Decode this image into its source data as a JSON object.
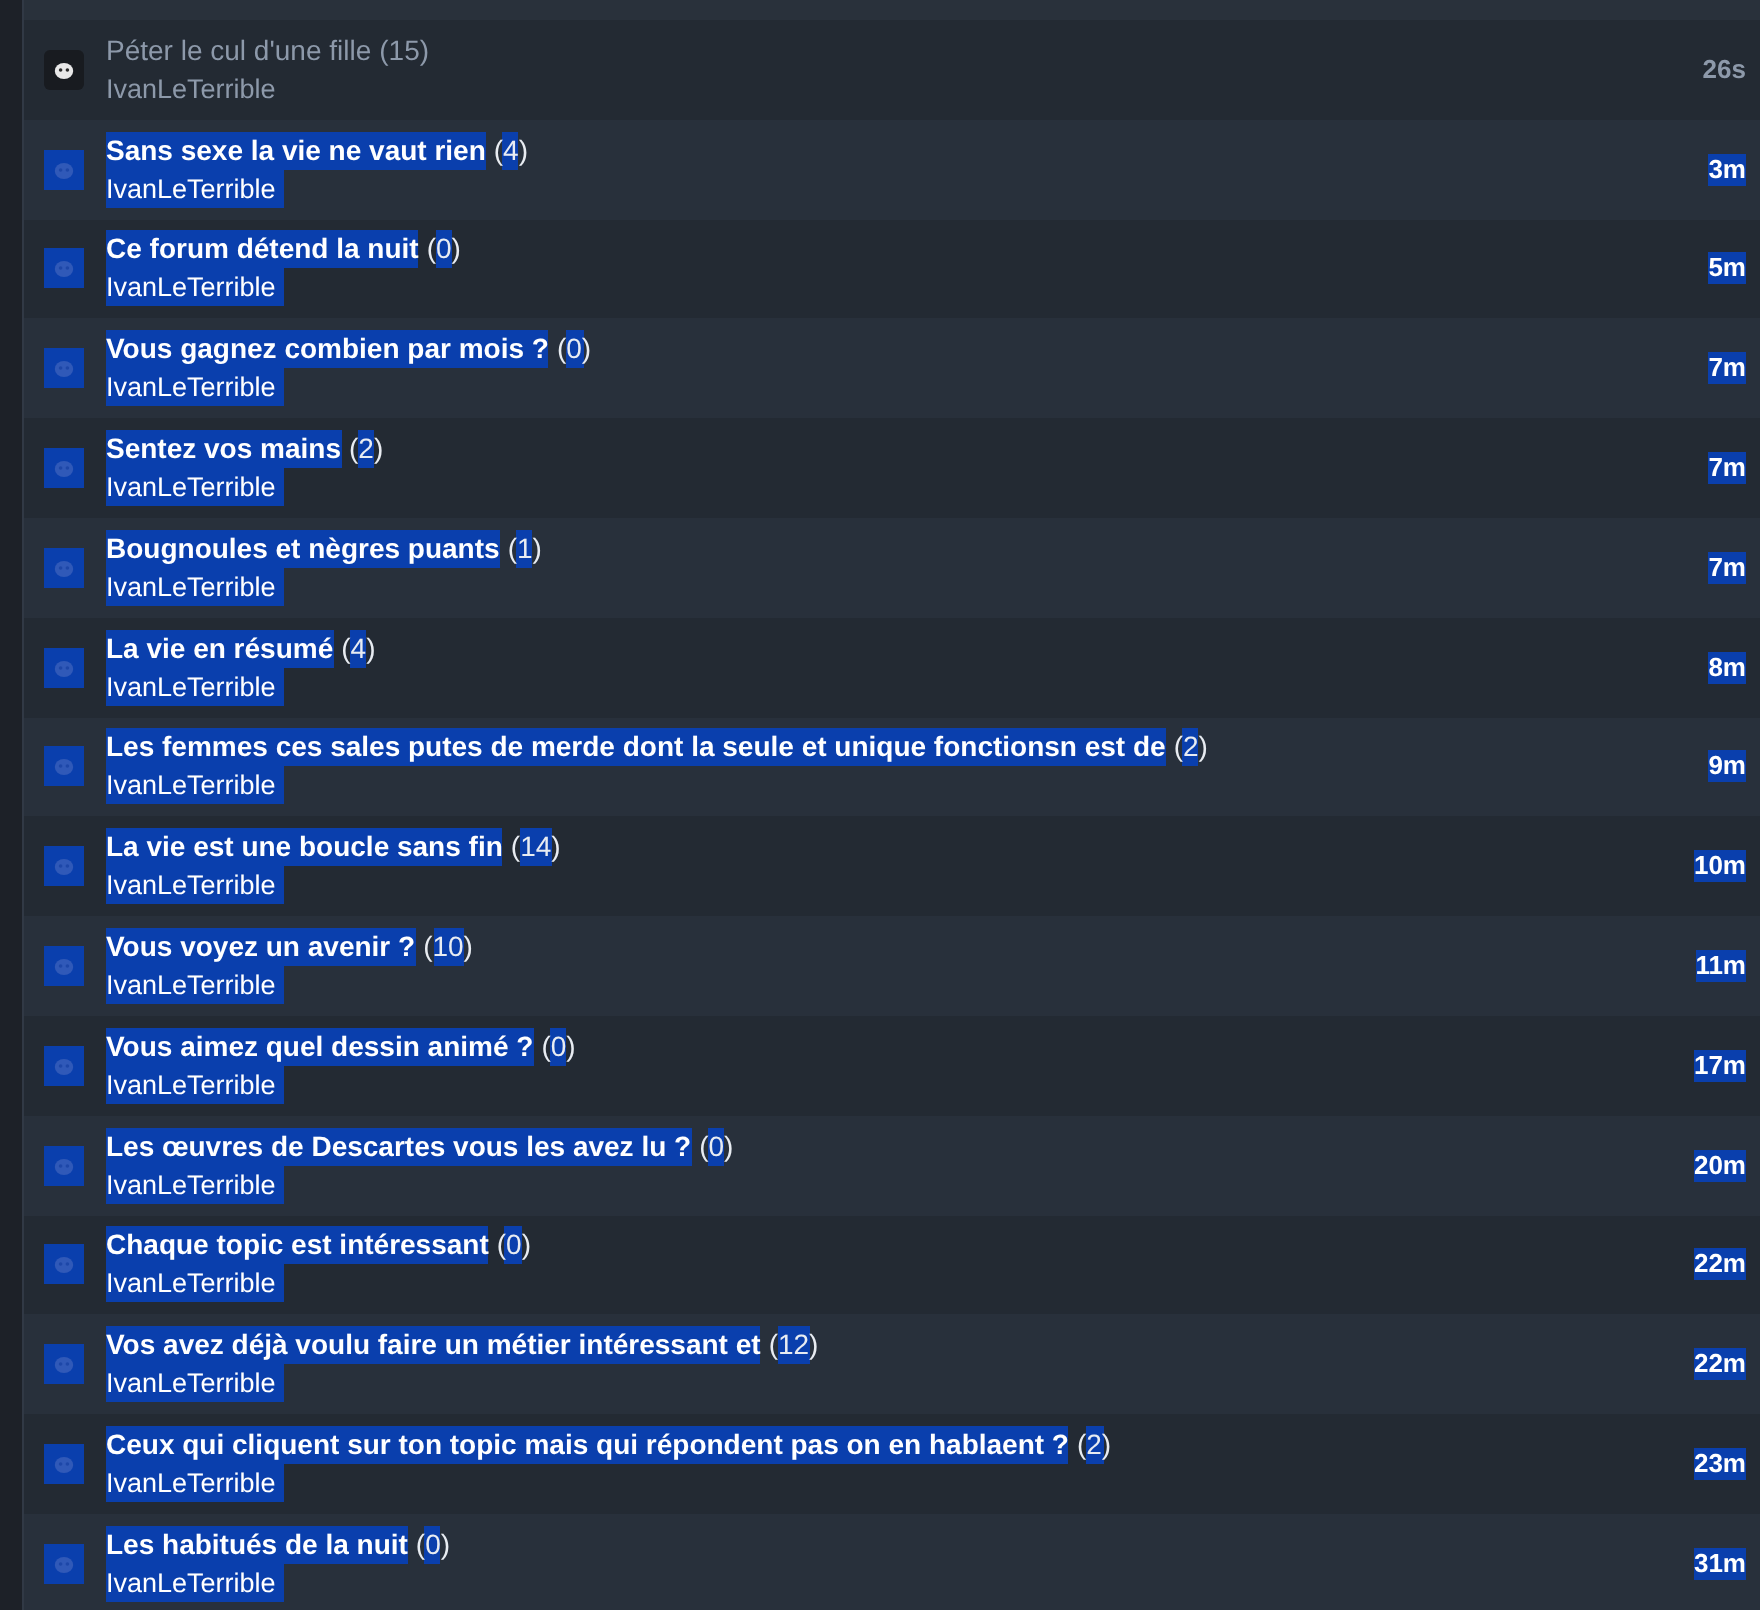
{
  "topics": [
    {
      "title": "Péter le cul d'une fille",
      "count": "(15)",
      "author": "IvanLeTerrible",
      "time": "26s",
      "selected": false
    },
    {
      "title": "Sans sexe la vie ne vaut rien",
      "count": "(4)",
      "author": "IvanLeTerrible",
      "time": "3m",
      "selected": true
    },
    {
      "title": "Ce forum détend la nuit",
      "count": "(0)",
      "author": "IvanLeTerrible",
      "time": "5m",
      "selected": true
    },
    {
      "title": "Vous gagnez combien par mois ?",
      "count": "(0)",
      "author": "IvanLeTerrible",
      "time": "7m",
      "selected": true
    },
    {
      "title": "Sentez vos mains",
      "count": "(2)",
      "author": "IvanLeTerrible",
      "time": "7m",
      "selected": true
    },
    {
      "title": "Bougnoules et nègres puants",
      "count": "(1)",
      "author": "IvanLeTerrible",
      "time": "7m",
      "selected": true
    },
    {
      "title": "La vie en résumé",
      "count": "(4)",
      "author": "IvanLeTerrible",
      "time": "8m",
      "selected": true
    },
    {
      "title": "Les femmes ces sales putes de merde dont la seule et unique fonctionsn est de",
      "count": "(2)",
      "author": "IvanLeTerrible",
      "time": "9m",
      "selected": true
    },
    {
      "title": "La vie est une boucle sans fin",
      "count": "(14)",
      "author": "IvanLeTerrible",
      "time": "10m",
      "selected": true
    },
    {
      "title": "Vous voyez un avenir ?",
      "count": "(10)",
      "author": "IvanLeTerrible",
      "time": "11m",
      "selected": true
    },
    {
      "title": "Vous aimez quel dessin animé ?",
      "count": "(0)",
      "author": "IvanLeTerrible",
      "time": "17m",
      "selected": true
    },
    {
      "title": "Les œuvres de Descartes vous les avez lu ?",
      "count": "(0)",
      "author": "IvanLeTerrible",
      "time": "20m",
      "selected": true
    },
    {
      "title": "Chaque topic est intéressant",
      "count": "(0)",
      "author": "IvanLeTerrible",
      "time": "22m",
      "selected": true
    },
    {
      "title": "Vos avez déjà voulu faire un métier intéressant et",
      "count": "(12)",
      "author": "IvanLeTerrible",
      "time": "22m",
      "selected": true
    },
    {
      "title": "Ceux qui cliquent sur ton topic mais qui répondent pas on en hablaent ?",
      "count": "(2)",
      "author": "IvanLeTerrible",
      "time": "23m",
      "selected": true
    },
    {
      "title": "Les habitués de la nuit",
      "count": "(0)",
      "author": "IvanLeTerrible",
      "time": "31m",
      "selected": true
    }
  ]
}
